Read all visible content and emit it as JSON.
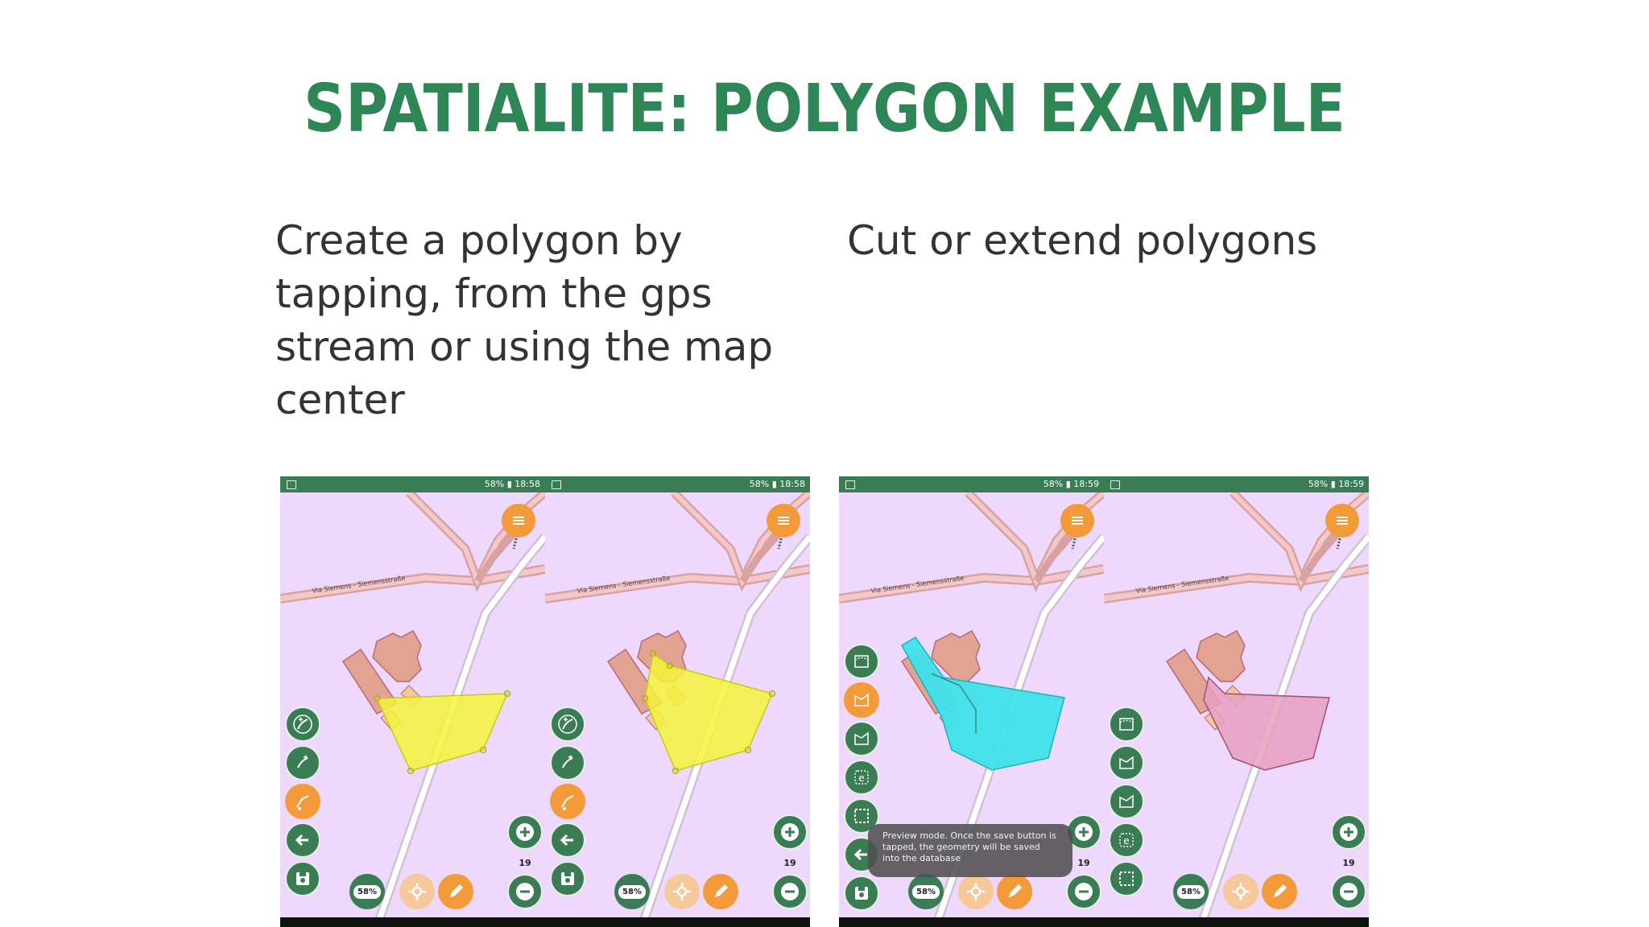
{
  "slide": {
    "title": "SPATIALITE: POLYGON EXAMPLE",
    "left_text": "Create a polygon by tapping, from the gps stream or using the map center",
    "right_text": "Cut or extend polygons"
  },
  "phones": [
    {
      "time": "18:58",
      "battery": "58%",
      "zoom": "19",
      "badge": "58%",
      "street": "Via Siemens - Siemensstraße"
    },
    {
      "time": "18:58",
      "battery": "58%",
      "zoom": "19",
      "badge": "58%",
      "street": "Via Siemens - Siemensstraße"
    },
    {
      "time": "18:59",
      "battery": "58%",
      "zoom": "19",
      "badge": "58%",
      "street": "Via Siemens - Siemensstraße",
      "toast": "Preview mode. Once the save button is tapped, the geometry will be saved into the database"
    },
    {
      "time": "18:59",
      "battery": "58%",
      "zoom": "19",
      "badge": "58%",
      "street": "Via Siemens - Siemensstraße"
    }
  ],
  "colors": {
    "title": "#2e8556",
    "statusbar": "#3a7d54",
    "map_bg": "#eed8fb",
    "accent": "#f39a3a",
    "polygon_yellow": "#f5f53a",
    "polygon_cyan": "#3de3ea",
    "polygon_pink": "#e7a0c0"
  }
}
